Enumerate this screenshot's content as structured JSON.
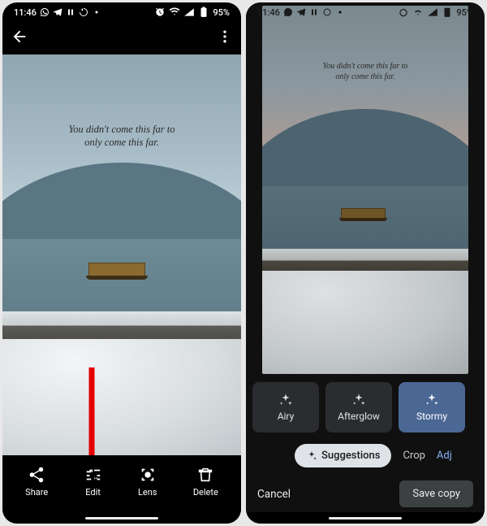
{
  "status": {
    "time": "11:46",
    "battery_text": "95%"
  },
  "photo": {
    "quote_line1": "You didn't come this far to",
    "quote_line2": "only come this far."
  },
  "left_actions": {
    "share": "Share",
    "edit": "Edit",
    "lens": "Lens",
    "delete": "Delete"
  },
  "editor": {
    "filters": [
      {
        "label": "Airy",
        "selected": false
      },
      {
        "label": "Afterglow",
        "selected": false
      },
      {
        "label": "Stormy",
        "selected": true
      }
    ],
    "categories": {
      "suggestions": "Suggestions",
      "crop": "Crop",
      "adjust_truncated": "Adj"
    },
    "cancel": "Cancel",
    "save": "Save copy"
  }
}
